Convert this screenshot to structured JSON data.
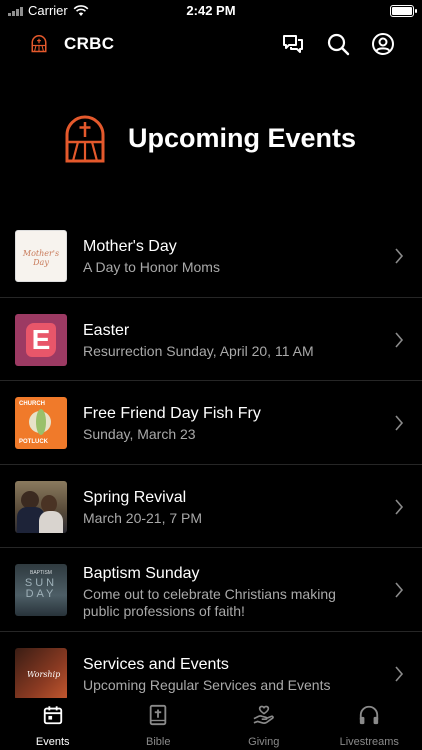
{
  "status": {
    "carrier": "Carrier",
    "time": "2:42 PM"
  },
  "header": {
    "brand": "CRBC"
  },
  "hero": {
    "title": "Upcoming Events"
  },
  "events": [
    {
      "title": "Mother's Day",
      "subtitle": "A Day to Honor Moms",
      "thumb_text": "Mother's Day"
    },
    {
      "title": "Easter",
      "subtitle": "Resurrection Sunday, April 20, 11 AM",
      "thumb_text": "E"
    },
    {
      "title": "Free Friend Day Fish Fry",
      "subtitle": "Sunday, March 23",
      "thumb_text_top": "CHURCH",
      "thumb_text_bottom": "POTLUCK"
    },
    {
      "title": "Spring Revival",
      "subtitle": "March 20-21, 7 PM"
    },
    {
      "title": "Baptism Sunday",
      "subtitle": "Come out to celebrate Christians making public professions of faith!",
      "thumb_text_top": "BAPTISM",
      "thumb_text": "SUN DAY"
    },
    {
      "title": "Services and Events",
      "subtitle": "Upcoming Regular Services and Events",
      "thumb_text": "Worship"
    }
  ],
  "tabs": [
    {
      "label": "Events",
      "icon": "calendar-icon",
      "active": true
    },
    {
      "label": "Bible",
      "icon": "bible-icon",
      "active": false
    },
    {
      "label": "Giving",
      "icon": "giving-hand-icon",
      "active": false
    },
    {
      "label": "Livestreams",
      "icon": "headphones-icon",
      "active": false
    }
  ],
  "colors": {
    "accent": "#e4592c",
    "background": "#000000",
    "subtitle": "#a9a9a9",
    "divider": "#262626"
  }
}
